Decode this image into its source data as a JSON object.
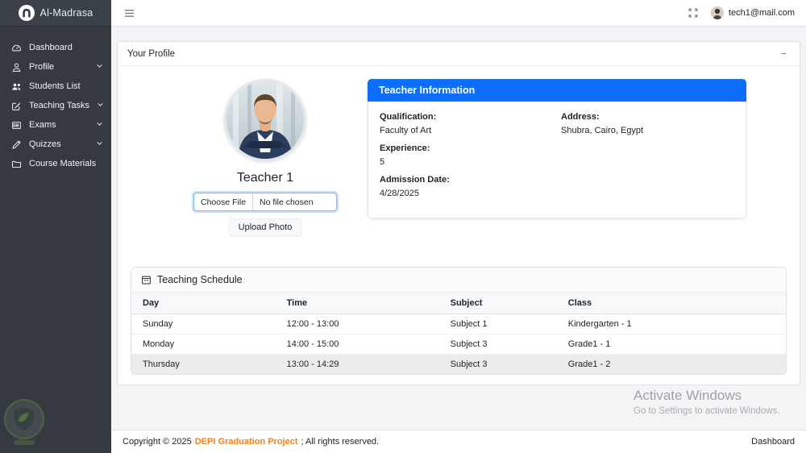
{
  "brand": {
    "name": "Al-Madrasa"
  },
  "sidebar": {
    "items": [
      {
        "label": "Dashboard"
      },
      {
        "label": "Profile",
        "chevron": "expand"
      },
      {
        "label": "Students List"
      },
      {
        "label": "Teaching Tasks",
        "chevron": "expand"
      },
      {
        "label": "Exams",
        "chevron": "expand"
      },
      {
        "label": "Quizzes",
        "chevron": "expand"
      },
      {
        "label": "Course Materials"
      }
    ]
  },
  "topbar": {
    "email": "tech1@mail.com"
  },
  "profile_card": {
    "title": "Your Profile",
    "collapse_label": "−"
  },
  "teacher": {
    "name": "Teacher 1",
    "file_input": {
      "button": "Choose File",
      "status": "No file chosen"
    },
    "upload_button": "Upload Photo"
  },
  "info": {
    "title": "Teacher Information",
    "left": [
      {
        "label": "Qualification:",
        "value": "Faculty of Art"
      },
      {
        "label": "Experience:",
        "value": "5"
      },
      {
        "label": "Admission Date:",
        "value": "4/28/2025"
      }
    ],
    "right": [
      {
        "label": "Address:",
        "value": "Shubra, Cairo, Egypt"
      }
    ]
  },
  "schedule": {
    "title": "Teaching Schedule",
    "columns": [
      "Day",
      "Time",
      "Subject",
      "Class"
    ],
    "rows": [
      [
        "Sunday",
        "12:00 - 13:00",
        "Subject 1",
        "Kindergarten - 1"
      ],
      [
        "Monday",
        "14:00 - 15:00",
        "Subject 3",
        "Grade1 - 1"
      ],
      [
        "Thursday",
        "13:00 - 14:29",
        "Subject 3",
        "Grade1 - 2"
      ]
    ]
  },
  "windows_watermark": {
    "title": "Activate Windows",
    "subtitle": "Go to Settings to activate Windows."
  },
  "footer": {
    "copyright": "Copyright © 2025",
    "link": "DEPI Graduation Project",
    "suffix": "; All rights reserved.",
    "right": "Dashboard"
  },
  "colors": {
    "accent_blue": "#0d6efd",
    "sidebar_dark": "#343a40",
    "link_orange": "#fd7e14",
    "striped_row": "#ececec"
  }
}
